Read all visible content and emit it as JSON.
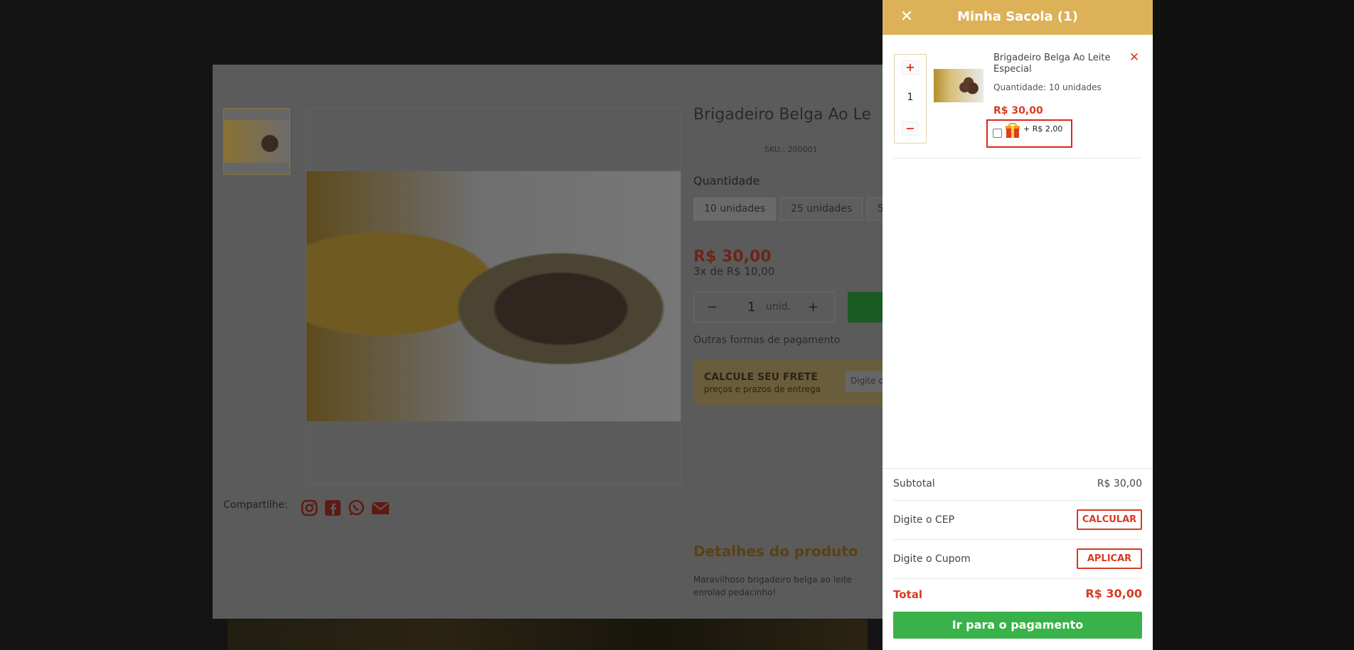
{
  "product_modal": {
    "title": "Brigadeiro Belga Ao Le",
    "sku": "SKU.: 200001",
    "quantity_label": "Quantidade",
    "options": [
      "10 unidades",
      "25 unidades",
      "5"
    ],
    "price": "R$ 30,00",
    "installments": "3x de R$ 10,00",
    "stepper_value": "1",
    "stepper_unit": "unid.",
    "other_payment": "Outras formas de pagamento",
    "shipping_title": "CALCULE SEU FRETE",
    "shipping_subtitle": "preços e prazos de entrega",
    "shipping_input": "Digite o",
    "share_label": "Compartilhe:",
    "details_title": "Detalhes do produto",
    "details_text": "Maravilhoso brigadeiro belga ao leite enrolad pedacinho!"
  },
  "cart": {
    "title": "Minha Sacola (1)",
    "item": {
      "quantity": "1",
      "name": "Brigadeiro Belga Ao Leite Especial",
      "quantity_text": "Quantidade: 10 unidades",
      "price": "R$ 30,00",
      "gift_price": "+ R$ 2,00"
    },
    "subtotal_label": "Subtotal",
    "subtotal_value": "R$ 30,00",
    "cep_label": "Digite o CEP",
    "cep_button": "CALCULAR",
    "coupon_label": "Digite o Cupom",
    "coupon_button": "APLICAR",
    "total_label": "Total",
    "total_value": "R$ 30,00",
    "checkout_button": "Ir para o pagamento"
  },
  "colors": {
    "header_gold": "#ddb158",
    "accent_red": "#d83a23",
    "checkout_green": "#3ab24a",
    "highlight_red": "#e0241b"
  },
  "icons": {
    "close": "close-icon",
    "remove": "remove-icon",
    "gift": "gift-icon",
    "instagram": "instagram-icon",
    "facebook": "facebook-icon",
    "whatsapp": "whatsapp-icon",
    "email": "email-icon"
  }
}
